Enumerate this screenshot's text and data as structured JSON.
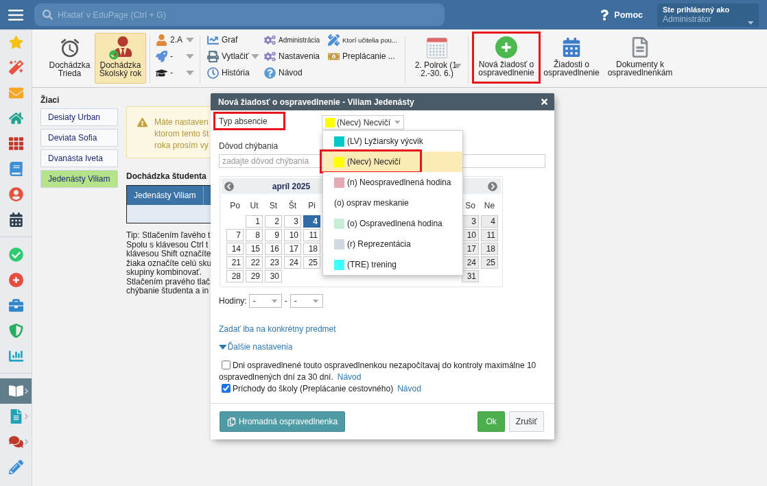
{
  "top_bar": {
    "search": {
      "placeholder": "Hľadať v EduPage (Ctrl + G)"
    },
    "help": {
      "label": "Pomoc"
    },
    "user": {
      "caption": "Ste prihlásený ako",
      "name": "Administrátor"
    }
  },
  "sidebar": {
    "sections": [
      {
        "items": [
          {
            "selected": false
          },
          {
            "selected": false
          },
          {
            "selected": false
          },
          {
            "selected": false
          },
          {
            "selected": false
          },
          {
            "selected": false
          },
          {
            "selected": false
          },
          {
            "selected": false
          }
        ]
      },
      {
        "items": [
          {
            "selected": false
          },
          {
            "selected": false
          },
          {
            "selected": false
          },
          {
            "selected": false
          },
          {
            "selected": false
          }
        ]
      },
      {
        "items": [
          {
            "selected": true,
            "submenu": true
          },
          {
            "selected": false,
            "submenu": true
          },
          {
            "selected": false,
            "submenu": true
          },
          {
            "selected": false,
            "submenu": false
          }
        ]
      }
    ]
  },
  "toolbar": {
    "views": [
      {
        "label": "Dochádzka\nTrieda",
        "selected": false
      },
      {
        "label": "Dochádzka\nŠkolský rok",
        "selected": true
      }
    ],
    "filters": [
      {
        "value": "2.A"
      },
      {
        "value": "-"
      },
      {
        "value": "-"
      }
    ],
    "menus": [
      [
        {
          "label": "Graf",
          "dropdown": false
        },
        {
          "label": "Vytlačiť",
          "dropdown": true
        },
        {
          "label": "História",
          "dropdown": false
        }
      ],
      [
        {
          "label": "Administrácia",
          "dropdown": false
        },
        {
          "label": "Nastavenia",
          "dropdown": false
        },
        {
          "label": "Návod",
          "dropdown": false
        }
      ],
      [
        {
          "label": "Ktorí učitelia pou...",
          "dropdown": false
        },
        {
          "label": "Preplácanie ...",
          "dropdown": false
        }
      ]
    ],
    "period": {
      "label": "2. Polrok (1.\n2.-30. 6.)"
    },
    "actions": [
      {
        "label": "Nová žiadosť o\nospravedlnenie",
        "highlighted": true
      },
      {
        "label": "Žiadosti o\nospravedlnenie",
        "highlighted": false
      },
      {
        "label": "Dokumenty k\nospravedlnenkám",
        "highlighted": false
      }
    ]
  },
  "students": {
    "title": "Žiaci",
    "items": [
      {
        "name": "Desiaty Urban",
        "selected": false
      },
      {
        "name": "Deviata Sofia",
        "selected": false
      },
      {
        "name": "Dvanásta Iveta",
        "selected": false
      },
      {
        "name": "Jedenásty Viliam",
        "selected": true
      }
    ]
  },
  "warning": {
    "lines": [
      "Máte nastaven",
      "ktorom tento št",
      "roka prosím vy"
    ]
  },
  "attendance": {
    "title": "Dochádzka študenta",
    "table": {
      "columns": [
        "Jedenásty Viliam"
      ]
    }
  },
  "tip": {
    "lines": [
      "Tip: Stlačením ľavého t",
      "Spolu s klávesou Ctrl t",
      "klávesou Shift označíte",
      "žiaka označíte celú sku",
      "skupiny kombinovať.",
      "Stlačením pravého tlač",
      "chýbanie študenta a in"
    ]
  },
  "dialog": {
    "title": "Nová žiadosť o ospravedlnenie - Viliam Jedenásty",
    "absence_type": {
      "label": "Typ absencie",
      "highlighted": true,
      "value": "(Necv) Necvičí",
      "options": [
        {
          "label": "(LV) Lyžiarsky výcvik",
          "color": "#00c8c8",
          "selected": false,
          "highlighted": false
        },
        {
          "label": "(Necv) Necvičí",
          "color": "#ffff00",
          "selected": true,
          "highlighted": true
        },
        {
          "label": "(n) Neospravedlnená hodina",
          "color": "#e6a9b3",
          "selected": false,
          "highlighted": false
        },
        {
          "label": "(o) osprav meskanie",
          "selected": false,
          "highlighted": false
        },
        {
          "label": "(o) Ospravedlnená hodina",
          "color": "#c9eed8",
          "selected": false,
          "highlighted": false
        },
        {
          "label": "(r) Reprezentácia",
          "color": "#cfd9e2",
          "selected": false,
          "highlighted": false
        },
        {
          "label": "(TRE) trening",
          "color": "#40ffff",
          "selected": false,
          "highlighted": false
        }
      ]
    },
    "reason": {
      "label": "Dôvod chýbania",
      "placeholder": "zadajte dôvod chýbania"
    },
    "calendar": {
      "months": [
        {
          "title": "apríl 2025",
          "weekdays": [
            {
              "kind": "label",
              "text": "Po"
            },
            {
              "kind": "label",
              "text": "Ut"
            },
            {
              "kind": "label",
              "text": "St"
            },
            {
              "kind": "label",
              "text": "Št"
            },
            {
              "kind": "label",
              "text": "Pi"
            }
          ],
          "weeks": [
            [
              {
                "kind": "blank"
              },
              {
                "kind": "day",
                "text": "1",
                "selected": false
              },
              {
                "kind": "day",
                "text": "2",
                "selected": false
              },
              {
                "kind": "day",
                "text": "3",
                "selected": false
              },
              {
                "kind": "day",
                "text": "4",
                "selected": true
              }
            ],
            [
              {
                "kind": "day",
                "text": "7",
                "selected": false
              },
              {
                "kind": "day",
                "text": "8",
                "selected": false
              },
              {
                "kind": "day",
                "text": "9",
                "selected": false
              },
              {
                "kind": "day",
                "text": "10",
                "selected": false
              },
              {
                "kind": "day",
                "text": "11",
                "selected": false
              }
            ],
            [
              {
                "kind": "day",
                "text": "14",
                "selected": false
              },
              {
                "kind": "day",
                "text": "15",
                "selected": false
              },
              {
                "kind": "day",
                "text": "16",
                "selected": false
              },
              {
                "kind": "day",
                "text": "17",
                "selected": false
              },
              {
                "kind": "day",
                "text": "18",
                "selected": false
              }
            ],
            [
              {
                "kind": "day",
                "text": "21",
                "selected": false
              },
              {
                "kind": "day",
                "text": "22",
                "selected": false
              },
              {
                "kind": "day",
                "text": "23",
                "selected": false
              },
              {
                "kind": "day",
                "text": "24",
                "selected": false
              },
              {
                "kind": "day",
                "text": "25",
                "selected": false
              }
            ],
            [
              {
                "kind": "day",
                "text": "28",
                "selected": false
              },
              {
                "kind": "day",
                "text": "29",
                "selected": false
              },
              {
                "kind": "day",
                "text": "30",
                "selected": false
              }
            ]
          ]
        },
        {
          "weekdays": [
            {
              "kind": "blank"
            },
            {
              "kind": "blank"
            },
            {
              "kind": "blank"
            },
            {
              "kind": "blank"
            },
            {
              "kind": "blank"
            },
            {
              "kind": "label",
              "text": "So"
            },
            {
              "kind": "label",
              "text": "Ne"
            }
          ],
          "weeks": [
            [
              {
                "kind": "blank"
              },
              {
                "kind": "blank"
              },
              {
                "kind": "blank"
              },
              {
                "kind": "blank"
              },
              {
                "kind": "blank"
              },
              {
                "kind": "weekend",
                "text": "3",
                "selected": false
              },
              {
                "kind": "weekend",
                "text": "4",
                "selected": false
              }
            ],
            [
              {
                "kind": "blank"
              },
              {
                "kind": "blank"
              },
              {
                "kind": "blank"
              },
              {
                "kind": "blank"
              },
              {
                "kind": "blank"
              },
              {
                "kind": "weekend",
                "text": "10",
                "selected": false
              },
              {
                "kind": "weekend",
                "text": "11",
                "selected": false
              }
            ],
            [
              {
                "kind": "blank"
              },
              {
                "kind": "blank"
              },
              {
                "kind": "blank"
              },
              {
                "kind": "blank"
              },
              {
                "kind": "blank"
              },
              {
                "kind": "weekend",
                "text": "17",
                "selected": false
              },
              {
                "kind": "weekend",
                "text": "18",
                "selected": false
              }
            ],
            [
              {
                "kind": "blank"
              },
              {
                "kind": "blank"
              },
              {
                "kind": "blank"
              },
              {
                "kind": "blank"
              },
              {
                "kind": "blank"
              },
              {
                "kind": "weekend",
                "text": "24",
                "selected": false
              },
              {
                "kind": "weekend",
                "text": "25",
                "selected": false
              }
            ],
            [
              {
                "kind": "blank"
              },
              {
                "kind": "blank"
              },
              {
                "kind": "blank"
              },
              {
                "kind": "blank"
              },
              {
                "kind": "blank"
              },
              {
                "kind": "weekend",
                "text": "31",
                "selected": false
              }
            ]
          ]
        }
      ]
    },
    "hours": {
      "label": "Hodiny:",
      "from": "-",
      "separator": "-",
      "to": "-"
    },
    "subject_link": "Zadať iba na konkrétny predmet",
    "more_settings": {
      "label": "Ďalšie nastavenia",
      "expanded": true
    },
    "options": [
      {
        "label": "Dni ospravedlnené touto ospravedlnenkou nezapočítavaj do kontroly maximálne 10 ospravedlnených dní za 30 dní.",
        "checked": false,
        "link": "Návod"
      },
      {
        "label": "Príchody do školy (Preplácanie cestovného)",
        "checked": true,
        "link": "Návod"
      }
    ],
    "buttons": [
      {
        "kind": "bulk",
        "label": "Hromadná ospravedlnenka"
      },
      {
        "kind": "ok",
        "label": "Ok"
      },
      {
        "kind": "cancel",
        "label": "Zrušiť"
      }
    ]
  }
}
